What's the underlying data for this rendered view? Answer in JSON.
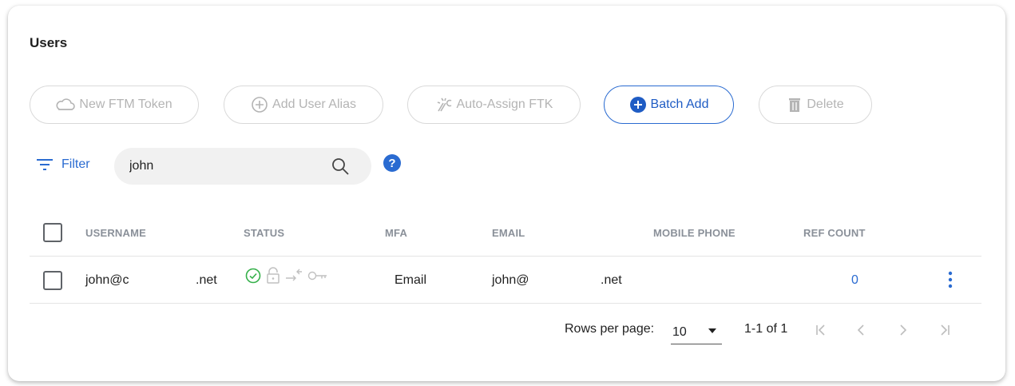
{
  "page": {
    "title": "Users"
  },
  "toolbar": {
    "new_ftm_token": "New FTM Token",
    "add_user_alias": "Add User Alias",
    "auto_assign_ftk": "Auto-Assign FTK",
    "batch_add": "Batch Add",
    "delete": "Delete"
  },
  "filter": {
    "label": "Filter",
    "search_value": "john",
    "help_glyph": "?"
  },
  "table": {
    "columns": [
      "USERNAME",
      "STATUS",
      "MFA",
      "EMAIL",
      "MOBILE PHONE",
      "REF COUNT"
    ],
    "rows": [
      {
        "username_prefix": "john@c",
        "username_suffix": ".net",
        "status_icons": [
          "check-circle-icon",
          "unlock-icon",
          "arrow-merge-icon",
          "key-icon"
        ],
        "mfa": "Email",
        "email_prefix": "john@",
        "email_suffix": ".net",
        "mobile_phone": "",
        "ref_count": "0"
      }
    ]
  },
  "pagination": {
    "rows_per_page_label": "Rows per page:",
    "rows_per_page": "10",
    "range": "1-1 of 1"
  },
  "colors": {
    "accent": "#2a6bd1",
    "disabled_text": "#b4b4b4",
    "status_ok": "#35b04a",
    "header_text": "#8a9099"
  }
}
